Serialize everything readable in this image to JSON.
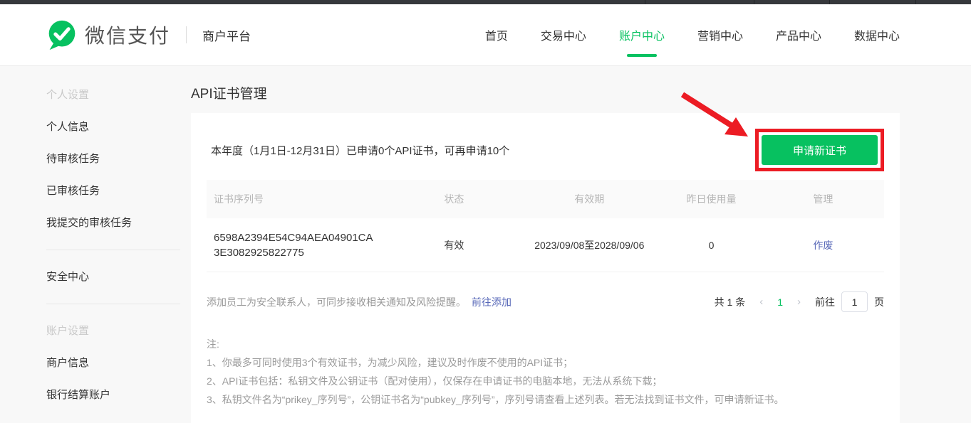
{
  "header": {
    "logo_text": "微信支付",
    "subtitle": "商户平台",
    "nav": [
      {
        "label": "首页"
      },
      {
        "label": "交易中心"
      },
      {
        "label": "账户中心",
        "active": true
      },
      {
        "label": "营销中心"
      },
      {
        "label": "产品中心"
      },
      {
        "label": "数据中心"
      }
    ]
  },
  "sidebar": {
    "sections": [
      {
        "header": "个人设置",
        "items": [
          "个人信息",
          "待审核任务",
          "已审核任务",
          "我提交的审核任务"
        ]
      },
      {
        "header": "",
        "items": [
          "安全中心"
        ]
      },
      {
        "header": "账户设置",
        "items": [
          "商户信息",
          "银行结算账户"
        ]
      }
    ]
  },
  "main": {
    "page_title": "API证书管理",
    "quota_text": "本年度（1月1日-12月31日）已申请0个API证书，可再申请10个",
    "apply_button_label": "申请新证书",
    "table": {
      "columns": [
        "证书序列号",
        "状态",
        "有效期",
        "昨日使用量",
        "管理"
      ],
      "rows": [
        {
          "serial": "6598A2394E54C94AEA04901CA3E3082925822775",
          "serial_line1": "6598A2394E54C94AEA04901CA",
          "serial_line2": "3E3082925822775",
          "status": "有效",
          "validity": "2023/09/08至2028/09/06",
          "usage": "0",
          "action": "作废"
        }
      ]
    },
    "contact_tip": "添加员工为安全联系人，可同步接收相关通知及风险提醒。",
    "contact_link": "前往添加",
    "pagination": {
      "total": "共 1 条",
      "prev": "‹",
      "current": "1",
      "next": "›",
      "goto_label": "前往",
      "page_value": "1",
      "page_suffix": "页"
    },
    "notes": {
      "title": "注:",
      "items": [
        "1、你最多可同时使用3个有效证书，为减少风险，建议及时作废不使用的API证书；",
        "2、API证书包括：私钥文件及公钥证书（配对使用），仅保存在申请证书的电脑本地，无法从系统下载；",
        "3、私钥文件名为“prikey_序列号”，公钥证书名为“pubkey_序列号”，序列号请查看上述列表。若无法找到证书文件，可申请新证书。"
      ]
    }
  },
  "annotation": {
    "type": "red arrow pointing to boxed button",
    "color": "#ec1c24"
  },
  "colors": {
    "brand_green": "#07c160",
    "link_blue": "#5868b8",
    "annotation_red": "#ec1c24",
    "page_background": "#f8f8f8"
  }
}
